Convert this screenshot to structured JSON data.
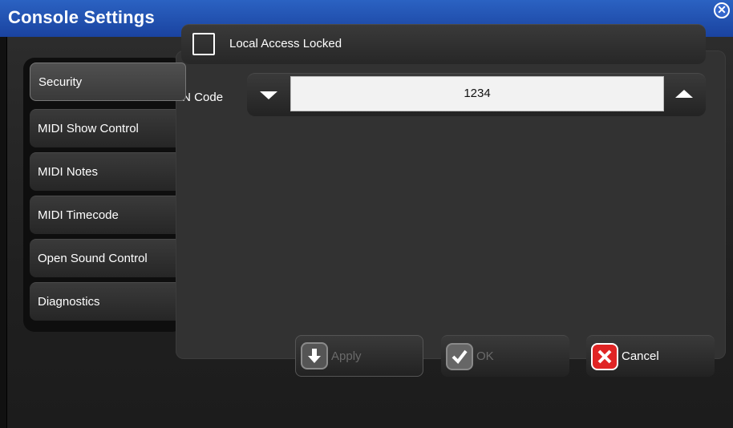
{
  "window": {
    "title": "Console Settings"
  },
  "tabs": [
    {
      "label": "Security",
      "active": true
    },
    {
      "label": "MIDI Show Control",
      "active": false
    },
    {
      "label": "MIDI Notes",
      "active": false
    },
    {
      "label": "MIDI Timecode",
      "active": false
    },
    {
      "label": "Open Sound Control",
      "active": false
    },
    {
      "label": "Diagnostics",
      "active": false
    }
  ],
  "security": {
    "local_access_label": "Local Access Locked",
    "local_access_checked": false,
    "pin_label": "PIN Code",
    "pin_value": "1234"
  },
  "buttons": {
    "apply": {
      "label": "Apply",
      "enabled": false
    },
    "ok": {
      "label": "OK",
      "enabled": false
    },
    "cancel": {
      "label": "Cancel",
      "enabled": true
    }
  },
  "icons": {
    "close": "close-circle-icon",
    "apply": "download-arrow-icon",
    "ok": "checkmark-icon",
    "cancel": "x-icon",
    "pin_down": "triangle-down-icon",
    "pin_up": "triangle-up-icon"
  },
  "colors": {
    "title_bar": "#2556b8",
    "cancel_icon": "#e02424",
    "disabled_text": "#6a6a6a"
  }
}
